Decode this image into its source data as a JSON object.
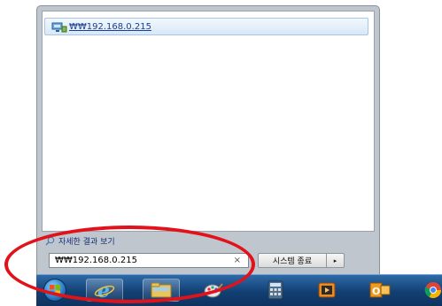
{
  "start_menu": {
    "results": [
      {
        "label": "₩₩192.168.0.215",
        "icon": "network-folder-icon"
      }
    ],
    "see_more_label": "자세한 결과 보기",
    "search": {
      "value": "₩₩192.168.0.215",
      "clear_glyph": "×"
    },
    "shutdown": {
      "label": "시스템 종료",
      "arrow_glyph": "▸"
    }
  },
  "taskbar": {
    "items": [
      {
        "name": "start-orb",
        "icon": "windows-flag-icon"
      },
      {
        "name": "internet-explorer",
        "icon": "ie-icon"
      },
      {
        "name": "windows-explorer",
        "icon": "folder-icon"
      },
      {
        "name": "paint",
        "icon": "paint-icon"
      },
      {
        "name": "calculator",
        "icon": "calculator-icon"
      },
      {
        "name": "media-player",
        "icon": "media-player-icon"
      },
      {
        "name": "outlook",
        "icon": "outlook-icon"
      },
      {
        "name": "chrome",
        "icon": "chrome-icon"
      }
    ]
  },
  "annotation": {
    "color": "#e3121a"
  }
}
